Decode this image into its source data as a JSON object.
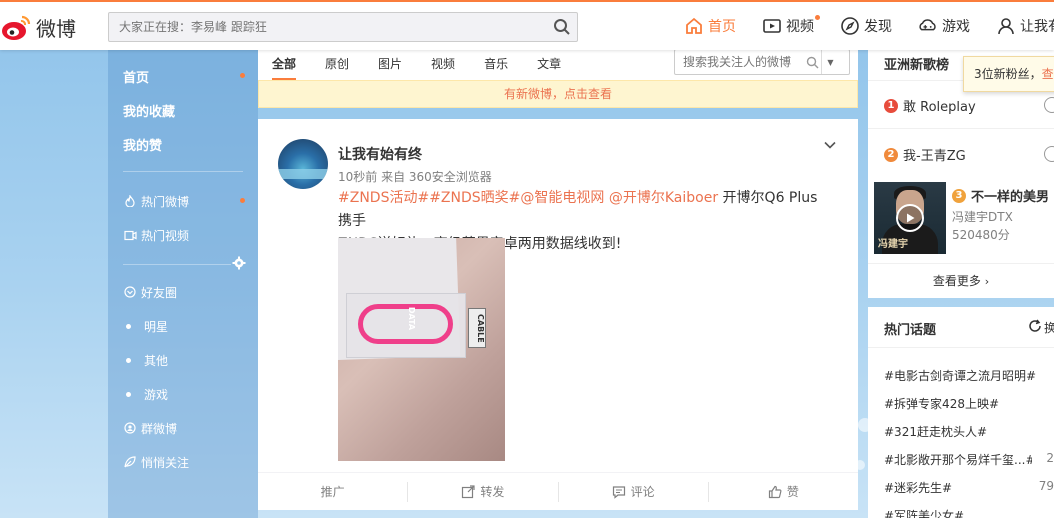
{
  "brand": {
    "logo_text": "微博"
  },
  "search": {
    "placeholder": "大家正在搜：李易峰 跟踪狂"
  },
  "nav": [
    {
      "label": "首页",
      "icon": "home-icon",
      "active": true
    },
    {
      "label": "视频",
      "icon": "video-icon",
      "badge": true
    },
    {
      "label": "发现",
      "icon": "compass-icon"
    },
    {
      "label": "游戏",
      "icon": "game-icon"
    },
    {
      "label": "让我有始",
      "icon": "user-icon"
    }
  ],
  "sidebar": {
    "main": [
      {
        "label": "首页",
        "dot": true
      },
      {
        "label": "我的收藏"
      },
      {
        "label": "我的赞"
      }
    ],
    "hot": [
      {
        "label": "热门微博",
        "icon": "fire-icon",
        "dot": true
      },
      {
        "label": "热门视频",
        "icon": "video-icon"
      }
    ],
    "groups": [
      {
        "label": "好友圈",
        "icon": "friends-icon"
      },
      {
        "label": "明星"
      },
      {
        "label": "其他"
      },
      {
        "label": "游戏"
      },
      {
        "label": "群微博",
        "icon": "group-icon"
      },
      {
        "label": "悄悄关注",
        "icon": "leaf-icon"
      }
    ]
  },
  "feed": {
    "tabs": [
      "全部",
      "原创",
      "图片",
      "视频",
      "音乐",
      "文章"
    ],
    "active_tab": "全部",
    "search_placeholder": "搜索我关注人的微博",
    "notice": "有新微博，点击查看",
    "post": {
      "author": "让我有始有终",
      "meta": "10秒前 来自 360安全浏览器",
      "tags": [
        "#ZNDS活动#",
        "#ZNDS晒奖#",
        "@智能电视网",
        " @开博尔Kaiboer"
      ],
      "text_after_tags": " 开博尔Q6 Plus携手",
      "text_line2": "ZNDS送好礼，高级苹果安卓两用数据线收到!",
      "photo": {
        "label_text": "CABLE",
        "label_text2": "DATA"
      },
      "actions": [
        {
          "label": "推广",
          "icon": ""
        },
        {
          "label": "转发",
          "icon": "share-icon"
        },
        {
          "label": "评论",
          "icon": "comment-icon"
        },
        {
          "label": "赞",
          "icon": "like-icon"
        }
      ]
    }
  },
  "right": {
    "music": {
      "title": "亚洲新歌榜",
      "songs": [
        {
          "rank": "1",
          "name": "敢 Roleplay",
          "color": "#e74c3c"
        },
        {
          "rank": "2",
          "name": "我-王青ZG",
          "color": "#f08a3c"
        },
        {
          "rank": "3",
          "name": "不一样的美男",
          "color": "#f0a23c",
          "artist": "冯建宇DTX",
          "plays": "520480分"
        }
      ],
      "thumb_text": "冯建宇",
      "more": "查看更多"
    },
    "topics": {
      "title": "热门话题",
      "refresh": "换",
      "items": [
        {
          "name": "#电影古剑奇谭之流月昭明#",
          "count": ""
        },
        {
          "name": "#拆弹专家428上映#",
          "count": ""
        },
        {
          "name": "#321赶走枕头人#",
          "count": ""
        },
        {
          "name": "#北影敞开那个易烊千玺...#",
          "count": "2"
        },
        {
          "name": "#迷彩先生#",
          "count": "79"
        },
        {
          "name": "#军阵美少女#",
          "count": ""
        }
      ]
    },
    "tooltip": {
      "text": "3位新粉丝，",
      "link": "查"
    }
  }
}
